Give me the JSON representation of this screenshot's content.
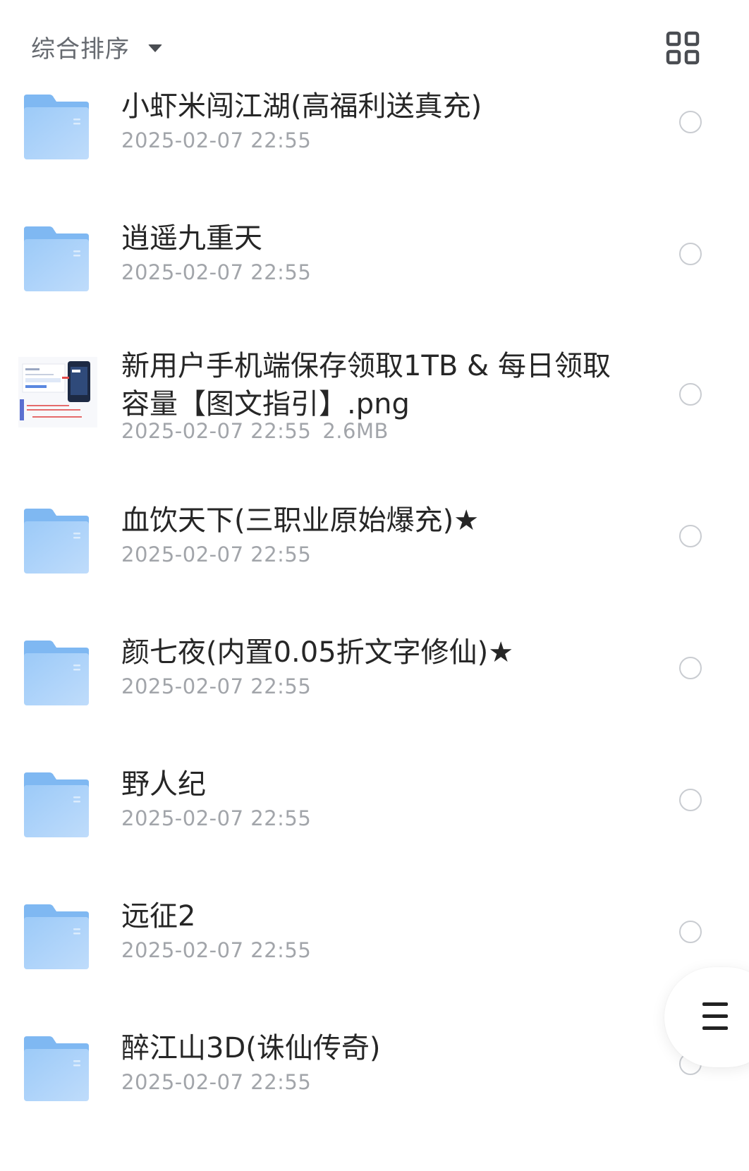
{
  "header": {
    "sort_label": "综合排序",
    "sort_dropdown_icon": "caret-down-icon",
    "view_toggle_icon": "grid-view-icon"
  },
  "files": [
    {
      "type": "folder",
      "name": "小虾米闯江湖(高福利送真充)",
      "date": "2025-02-07 22:55",
      "size": ""
    },
    {
      "type": "folder",
      "name": "逍遥九重天",
      "date": "2025-02-07 22:55",
      "size": ""
    },
    {
      "type": "image",
      "name": "新用户手机端保存领取1TB & 每日领取容量【图文指引】.png",
      "date": "2025-02-07 22:55",
      "size": "2.6MB"
    },
    {
      "type": "folder",
      "name": "血饮天下(三职业原始爆充)★",
      "date": "2025-02-07 22:55",
      "size": ""
    },
    {
      "type": "folder",
      "name": "颜七夜(内置0.05折文字修仙)★",
      "date": "2025-02-07 22:55",
      "size": ""
    },
    {
      "type": "folder",
      "name": "野人纪",
      "date": "2025-02-07 22:55",
      "size": ""
    },
    {
      "type": "folder",
      "name": "远征2",
      "date": "2025-02-07 22:55",
      "size": ""
    },
    {
      "type": "folder",
      "name": "醉江山3D(诛仙传奇)",
      "date": "2025-02-07 22:55",
      "size": ""
    }
  ],
  "floating_menu": {
    "icon": "menu-icon"
  },
  "colors": {
    "folder_top": "#7fb8f2",
    "folder_body": "#9ccaf8",
    "folder_body_light": "#bfdcfb",
    "meta_text": "#a2a5aa",
    "name_text": "#262626",
    "circle_border": "#c9ccd1"
  }
}
